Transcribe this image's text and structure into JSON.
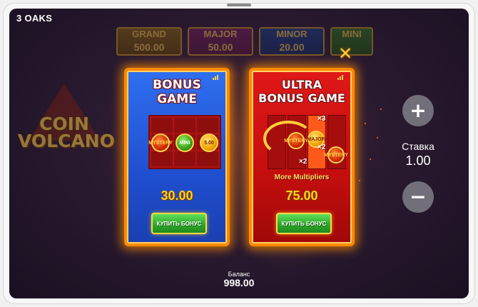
{
  "brand": "3 OAKS",
  "jackpots": [
    {
      "label": "GRAND",
      "value": "500.00"
    },
    {
      "label": "MAJOR",
      "value": "50.00"
    },
    {
      "label": "MINOR",
      "value": "20.00"
    },
    {
      "label": "MINI",
      "value": ""
    }
  ],
  "logo": {
    "line1": "COIN",
    "line2": "VOLCANO"
  },
  "bonus_card": {
    "title_line1": "BONUS",
    "title_line2": "GAME",
    "coins": [
      "MYSTERY",
      "MINI",
      "5.00"
    ],
    "price": "30.00",
    "buy_label": "КУПИТЬ БОНУС"
  },
  "ultra_card": {
    "title_line1": "ULTRA",
    "title_line2": "BONUS GAME",
    "multipliers": [
      "×3",
      "×2",
      "×2"
    ],
    "coins": [
      "MYSTERY",
      "MAJOR",
      "MYSTERY"
    ],
    "subtitle": "More Multipliers",
    "price": "75.00",
    "buy_label": "КУПИТЬ БОНУС"
  },
  "close_icon": "✕",
  "bet": {
    "label": "Ставка",
    "value": "1.00",
    "plus": "+",
    "minus": "−"
  },
  "balance": {
    "label": "Баланс",
    "value": "998.00"
  },
  "colors": {
    "bonus_card": "#2f6ff0",
    "ultra_card": "#e01818",
    "card_border": "#ff8a00",
    "price": "#ffd21a",
    "buy_button": "#2fa82a"
  }
}
